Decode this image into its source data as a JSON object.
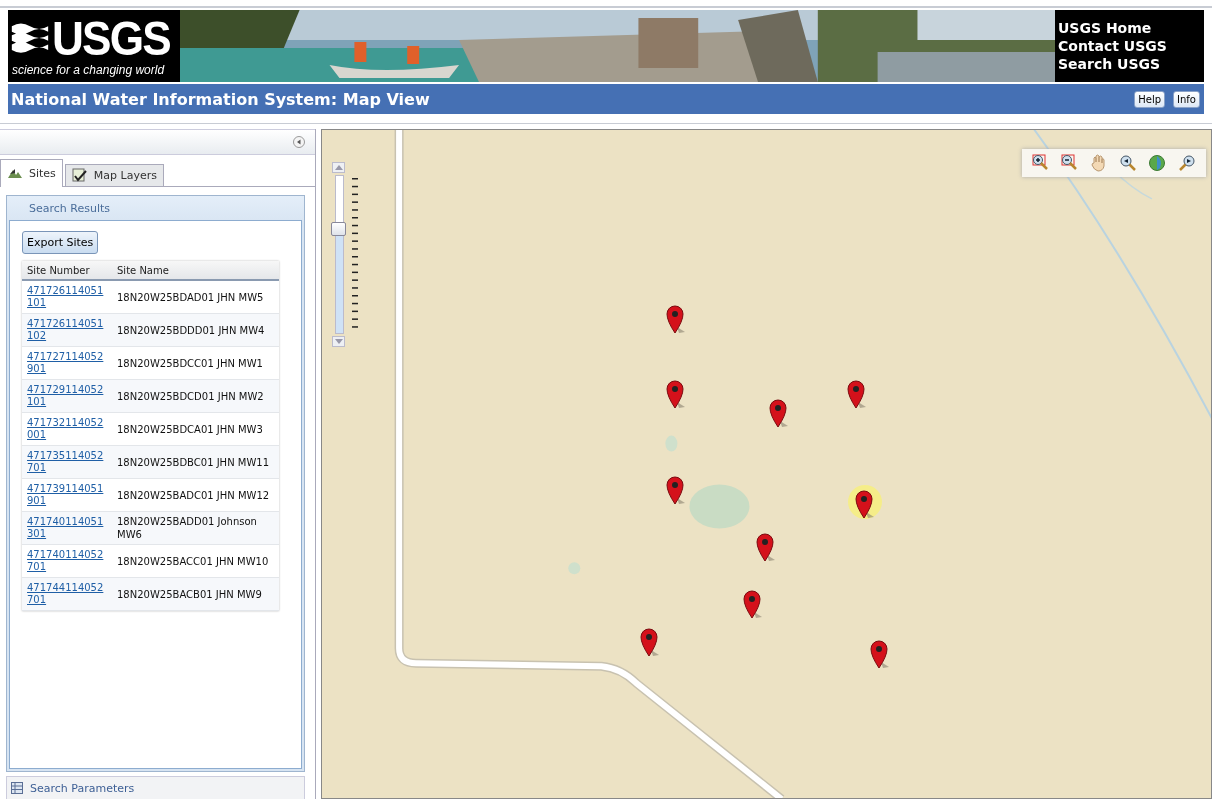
{
  "header": {
    "logo": {
      "wordmark": "USGS",
      "tagline": "science for a changing world"
    },
    "links": [
      "USGS Home",
      "Contact USGS",
      "Search USGS"
    ],
    "title": "National Water Information System: Map View",
    "buttons": [
      "Help",
      "Info"
    ]
  },
  "sidebar": {
    "tabs": [
      {
        "label": "Sites",
        "selected": true
      },
      {
        "label": "Map Layers",
        "selected": false
      }
    ],
    "panel_title": "Search Results",
    "export_button": "Export Sites",
    "table": {
      "columns": [
        "Site Number",
        "Site Name"
      ],
      "rows": [
        {
          "site_number": "471726114051101",
          "site_name": "18N20W25BDAD01 JHN MW5"
        },
        {
          "site_number": "471726114051102",
          "site_name": "18N20W25BDDD01 JHN MW4"
        },
        {
          "site_number": "471727114052901",
          "site_name": "18N20W25BDCC01 JHN MW1"
        },
        {
          "site_number": "471729114052101",
          "site_name": "18N20W25BDCD01 JHN MW2"
        },
        {
          "site_number": "471732114052001",
          "site_name": "18N20W25BDCA01 JHN MW3"
        },
        {
          "site_number": "471735114052701",
          "site_name": "18N20W25BDBC01 JHN MW11"
        },
        {
          "site_number": "471739114051901",
          "site_name": "18N20W25BADC01 JHN MW12"
        },
        {
          "site_number": "471740114051301",
          "site_name": "18N20W25BADD01 Johnson MW6"
        },
        {
          "site_number": "471740114052701",
          "site_name": "18N20W25BACC01 JHN MW10"
        },
        {
          "site_number": "471744114052701",
          "site_name": "18N20W25BACB01 JHN MW9"
        }
      ]
    },
    "bottom_section": "Search Parameters"
  },
  "map": {
    "zoom_slider": {
      "level": 0.67
    },
    "markers": [
      {
        "selected": false
      },
      {
        "selected": false
      },
      {
        "selected": false
      },
      {
        "selected": false
      },
      {
        "selected": false
      },
      {
        "selected": true
      },
      {
        "selected": false
      },
      {
        "selected": false
      },
      {
        "selected": false
      },
      {
        "selected": false
      }
    ]
  }
}
